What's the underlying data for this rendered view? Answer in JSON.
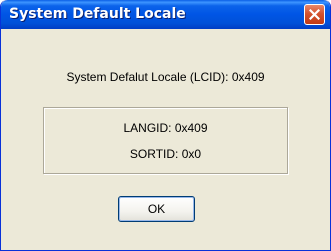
{
  "window": {
    "title": "System Default Locale"
  },
  "content": {
    "locale_line": "System Defalut Locale (LCID):  0x409",
    "langid_line": "LANGID:  0x409",
    "sortid_line": "SORTID:  0x0"
  },
  "buttons": {
    "ok_label": "OK",
    "close_icon": "close-x-icon"
  },
  "colors": {
    "titlebar": "#0055e5",
    "close_button": "#d4532f",
    "dialog_background": "#ece9d8",
    "button_border": "#003c74"
  }
}
